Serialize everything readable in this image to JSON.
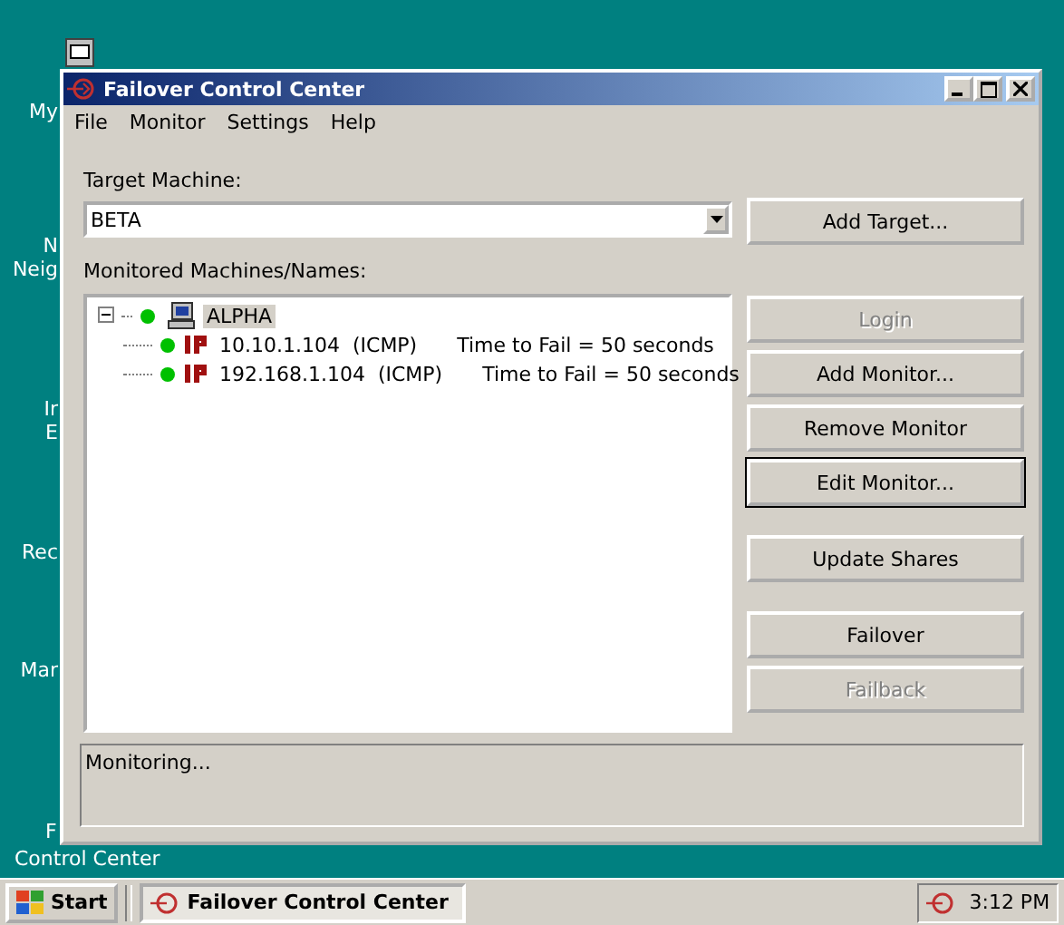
{
  "desktop_icons": [
    {
      "lines": [
        "My"
      ]
    },
    {
      "lines": [
        "N",
        "Neig"
      ]
    },
    {
      "lines": [
        "Ir",
        "E"
      ]
    },
    {
      "lines": [
        "Rec"
      ]
    },
    {
      "lines": [
        "Mar"
      ]
    },
    {
      "lines": [
        "F",
        "Control Center"
      ]
    }
  ],
  "window": {
    "title": "Failover Control Center"
  },
  "menu": [
    "File",
    "Monitor",
    "Settings",
    "Help"
  ],
  "target": {
    "label": "Target Machine:",
    "value": "BETA"
  },
  "tree_label": "Monitored Machines/Names:",
  "tree": [
    {
      "name": "ALPHA",
      "expanded": true,
      "selected": true,
      "color": "#00c000",
      "children": [
        {
          "address": "10.10.1.104",
          "protocol": "(ICMP)",
          "detail": "Time to Fail = 50 seconds",
          "color": "#00c000"
        },
        {
          "address": "192.168.1.104",
          "protocol": "(ICMP)",
          "detail": "Time to Fail = 50 seconds",
          "color": "#00c000"
        }
      ]
    }
  ],
  "buttons": [
    {
      "label": "Add Target...",
      "disabled": false,
      "focused": false
    },
    {
      "label": "Login",
      "disabled": true,
      "focused": false
    },
    {
      "label": "Add Monitor...",
      "disabled": false,
      "focused": false
    },
    {
      "label": "Remove Monitor",
      "disabled": false,
      "focused": false
    },
    {
      "label": "Edit Monitor...",
      "disabled": false,
      "focused": true
    },
    {
      "label": "Update Shares",
      "disabled": false,
      "focused": false
    },
    {
      "label": "Failover",
      "disabled": false,
      "focused": false
    },
    {
      "label": "Failback",
      "disabled": true,
      "focused": false
    }
  ],
  "status": "Monitoring...",
  "taskbar": {
    "start": "Start",
    "task": "Failover Control Center",
    "clock": "3:12 PM"
  }
}
